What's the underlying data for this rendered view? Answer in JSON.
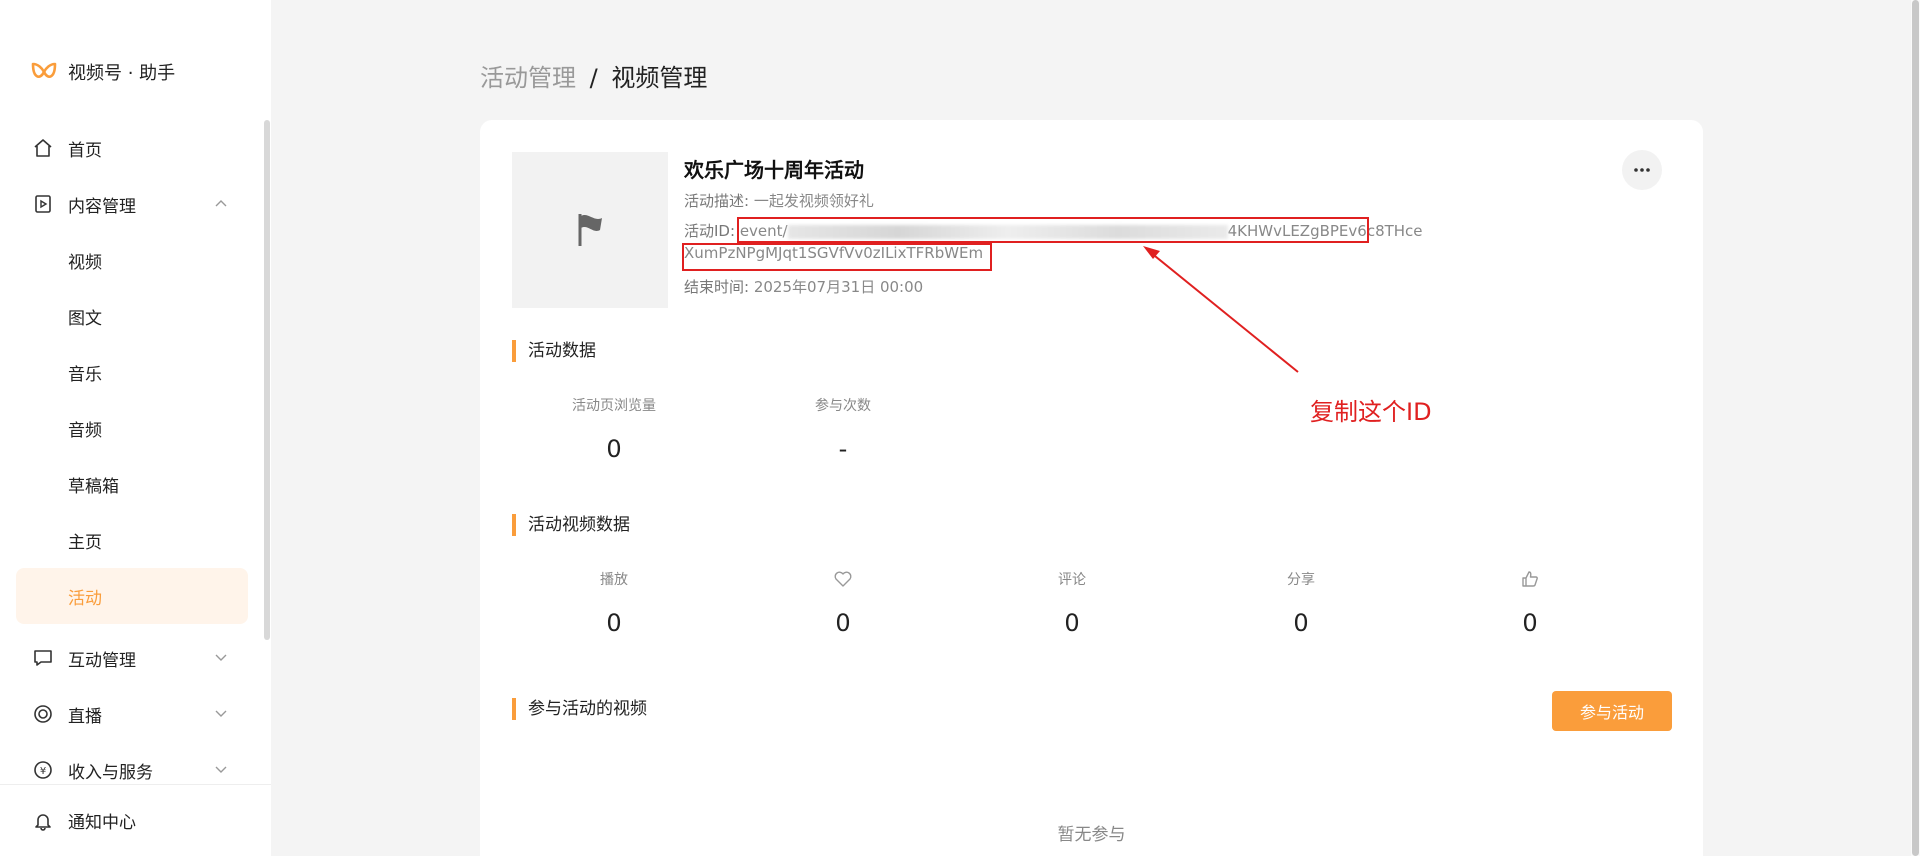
{
  "sidebar": {
    "logo_text": "视频号 · 助手",
    "items": [
      {
        "label": "首页",
        "icon": "home-icon"
      },
      {
        "label": "内容管理",
        "icon": "content-icon",
        "expanded": true,
        "children": [
          "视频",
          "图文",
          "音乐",
          "音频",
          "草稿箱",
          "主页",
          "活动"
        ]
      },
      {
        "label": "互动管理",
        "icon": "comment-icon"
      },
      {
        "label": "直播",
        "icon": "live-icon"
      },
      {
        "label": "收入与服务",
        "icon": "income-icon"
      }
    ],
    "active_child": "活动",
    "notify_label": "通知中心"
  },
  "breadcrumb": {
    "parent": "活动管理",
    "separator": "/",
    "current": "视频管理"
  },
  "event": {
    "title": "欢乐广场十周年活动",
    "desc_label": "活动描述:",
    "desc_value": "一起发视频领好礼",
    "id_label": "活动ID:",
    "id_prefix": "event/",
    "id_suffix_line1": "4KHWvLEZgBPEv6c8THce",
    "id_line2": "XumPzNPgMJqt1SGVfVv0zILixTFRbWEm",
    "end_label": "结束时间:",
    "end_value": "2025年07月31日 00:00"
  },
  "activity_data": {
    "title": "活动数据",
    "stats": [
      {
        "label": "活动页浏览量",
        "value": "0"
      },
      {
        "label": "参与次数",
        "value": "-"
      }
    ]
  },
  "video_data": {
    "title": "活动视频数据",
    "stats": [
      {
        "label": "播放",
        "value": "0"
      },
      {
        "label": "",
        "icon": "heart-icon",
        "value": "0"
      },
      {
        "label": "评论",
        "value": "0"
      },
      {
        "label": "分享",
        "value": "0"
      },
      {
        "label": "",
        "icon": "thumbs-up-icon",
        "value": "0"
      }
    ]
  },
  "participating": {
    "title": "参与活动的视频",
    "join_button": "参与活动",
    "empty_text": "暂无参与"
  },
  "annotation": {
    "text": "复制这个ID",
    "color": "#e02020"
  },
  "colors": {
    "accent": "#fa9d3b",
    "active_bg": "#fff4ea",
    "annotation": "#e02020"
  }
}
